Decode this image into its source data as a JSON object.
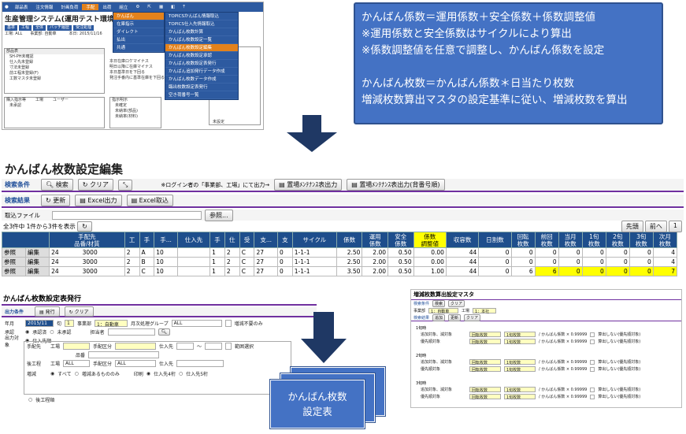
{
  "top_screen": {
    "nav_items": [
      "部品表",
      "注文情報",
      "計画負荷",
      "手配",
      "出荷",
      "組立",
      "",
      "",
      "",
      "",
      ""
    ],
    "nav_active_index": 3,
    "app_title": "生産管理システム(運用テスト環境",
    "tabs": [
      "基準",
      "工程",
      "全体",
      "バッチ履歴",
      "受注処理"
    ],
    "info_line": "工場: ALL　　事業部: 自動車　　",
    "info_date": "本日: 2015/11/16",
    "menu_level1": [
      "かんばん",
      "在庫指示",
      "ダイレクト",
      "払出",
      "共通"
    ],
    "menu_level2": [
      "TOPICSかんばん情報取込",
      "TOPICS仕入先情報取込",
      "かんばん枚数計算",
      "かんばん枚数設定一覧",
      "かんばん枚数設定編集",
      "かんばん枚数設定承認",
      "かんばん枚数設定表発行",
      "かんばん追加発行データ作成",
      "かんばん枚数データ作成",
      "臨出枚数設定表発行",
      "空き荷番号一覧"
    ],
    "left_links": [
      "部品表",
      "SH-PH未確認",
      "仕入先未登録",
      "寸法未登録",
      "前工程未登録(F)",
      "工数マスタ未登録"
    ],
    "left_links2": [
      "購入指示等",
      "未承認"
    ],
    "left_col2": [
      "工場",
      "ユーザー"
    ],
    "mid_links": [
      "本日在庫ロケマイナス",
      "明日以降に在庫マイナス",
      "本日基準日を下回る",
      "発注手番内に基準在庫を下回る"
    ],
    "mid_links2": [
      "指示明示",
      "未確定",
      "未納率(部品)",
      "未納率(材料)"
    ],
    "right_item": "未設定",
    "ellipsis": "..."
  },
  "callout": {
    "lines": [
      "かんばん係数＝運用係数＋安全係数＋係数調整値",
      "※運用係数と安全係数はサイクルにより算出",
      "※係数調整値を任意で調整し、かんばん係数を設定",
      "",
      "かんばん枚数＝かんばん係数＊日当たり枚数",
      "増減枚数算出マスタの設定基準に従い、増減枚数を算出"
    ]
  },
  "edit_screen": {
    "title": "かんばん枚数設定編集",
    "search_label": "検索条件",
    "search_btn": "検索",
    "clear_btn": "クリア",
    "login_note": "※ログイン者の「事業部、工場」にて出力→",
    "maint_btn1": "置場ﾒﾝﾃﾅﾝｽ表出力",
    "maint_btn2": "置場ﾒﾝﾃﾅﾝｽ表出力(背番号順)",
    "result_label": "検索結果",
    "update_btn": "更新",
    "excel_out_btn": "Excel出力",
    "excel_in_btn": "Excel取込",
    "import_label": "取込ファイル",
    "browse_btn": "参照...",
    "count_text": "全3件中 1件から3件を表示",
    "first_btn": "先頭",
    "prev_btn": "前へ",
    "page_num": "1",
    "columns": [
      "",
      "",
      "手配先\n品番/材質",
      "工",
      "手",
      "手...",
      "仕入先",
      "手",
      "仕",
      "受",
      "支...",
      "支",
      "サイクル",
      "係数",
      "運用\n係数",
      "安全\n係数",
      "係数\n調整値",
      "収容数",
      "日割数",
      "回転\n枚数",
      "前回\n枚数",
      "当月\n枚数",
      "1旬\n枚数",
      "2旬\n枚数",
      "3旬\n枚数",
      "次月\n枚数"
    ],
    "rows": [
      {
        "ref": "参照",
        "edit": "編集",
        "item": "24　　　　3000",
        "a": "2",
        "b": "A",
        "c": "10",
        "d": "",
        "e": "1",
        "f": "2",
        "g": "C",
        "h": "27",
        "i": "0",
        "cycle": "1-1-1",
        "k": "2.50",
        "op": "2.00",
        "sf": "0.50",
        "adj": "0.00",
        "cap": "44",
        "daily": "0",
        "rot": "0",
        "prev": "0",
        "m0": "0",
        "m1": "0",
        "m2": "0",
        "m3": "0",
        "next": "4"
      },
      {
        "ref": "参照",
        "edit": "編集",
        "item": "24　　　　3000",
        "a": "2",
        "b": "B",
        "c": "10",
        "d": "",
        "e": "1",
        "f": "2",
        "g": "C",
        "h": "27",
        "i": "0",
        "cycle": "1-1-1",
        "k": "2.50",
        "op": "2.00",
        "sf": "0.50",
        "adj": "0.00",
        "cap": "44",
        "daily": "0",
        "rot": "0",
        "prev": "0",
        "m0": "0",
        "m1": "0",
        "m2": "0",
        "m3": "0",
        "next": "4"
      },
      {
        "ref": "参照",
        "edit": "編集",
        "item": "24　　　　3000",
        "a": "2",
        "b": "C",
        "c": "10",
        "d": "",
        "e": "1",
        "f": "2",
        "g": "C",
        "h": "27",
        "i": "0",
        "cycle": "1-1-1",
        "k": "3.50",
        "op": "2.00",
        "sf": "0.50",
        "adj": "1.00",
        "cap": "44",
        "daily": "0",
        "rot": "6",
        "prev": "6",
        "m0": "0",
        "m1": "0",
        "m2": "0",
        "m3": "0",
        "next": "7"
      }
    ]
  },
  "issue_screen": {
    "title": "かんばん枚数設定表発行",
    "out_label": "出力条件",
    "issue_btn": "発行",
    "clear_btn": "クリア",
    "year_label": "年月",
    "year_value": "2015/11",
    "jun_label": "旬",
    "jun_value": "1",
    "div_label": "事業部",
    "div_value": "1：自動車",
    "group_label": "月次処理グループ",
    "group_value": "ALL",
    "no_change_label": "増減不要のみ",
    "approve_label": "承認",
    "approved": "承認済",
    "unapproved": "未承認",
    "person_label": "担当者",
    "target_label": "出力対象",
    "supplier_radio": "仕入先順",
    "supplier_label": "手配先",
    "factory_label": "工場",
    "kubun_label": "手配区分",
    "shiire_label": "仕入先",
    "tilde": "～",
    "range_label": "範囲選択",
    "hinban_label": "品番",
    "after_label": "後工程",
    "all_value": "ALL",
    "zougen_label": "増減",
    "r_all": "すべて",
    "r_changed": "増減あるもののみ",
    "print_label": "印刷",
    "r_s4": "仕入先4桁",
    "r_s5": "仕入先5桁",
    "after_order": "後工程順"
  },
  "doc_label": "かんばん枚数\n設定表",
  "master_screen": {
    "title": "増減枚数算出設定マスタ",
    "cond_label": "検索条件",
    "search_btn": "検索",
    "clear_btn": "クリア",
    "div_label": "事業部",
    "div_value": "1：自動車",
    "factory_label": "工場",
    "factory_value": "1：本社",
    "result_label": "検索結果",
    "add_btn": "追加",
    "update_btn": "更新",
    "clear2_btn": "クリア",
    "sections": [
      "1旬時",
      "2旬時",
      "3旬時"
    ],
    "line1_label": "追加対象、減対象",
    "line2_label": "優先順対象",
    "select1": "回転枚数",
    "select2": "1旬枚数",
    "formula": "/ かんばん係数 × 0.99999",
    "checkbox": "算出しない(優先順対象)"
  },
  "colors": {
    "navy": "#1e4e8c",
    "callout": "#4472c4",
    "orange": "#e3821c",
    "purple": "#7030a0",
    "arrow": "#1f3864",
    "yellow": "#ffff00"
  }
}
